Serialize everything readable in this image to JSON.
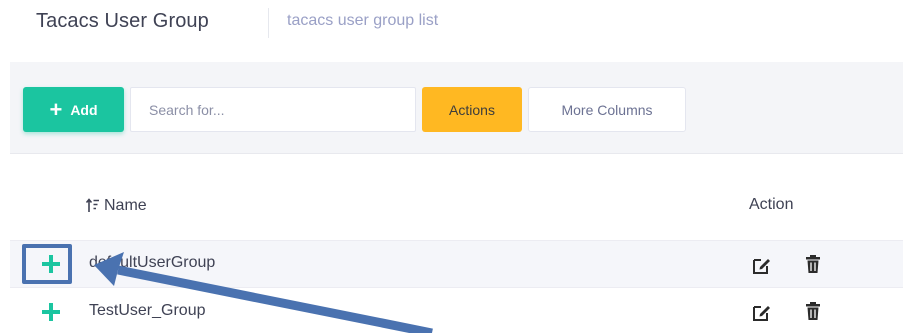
{
  "header": {
    "title": "Tacacs User Group",
    "subtitle": "tacacs user group list"
  },
  "toolbar": {
    "add_label": "Add",
    "search_placeholder": "Search for...",
    "actions_label": "Actions",
    "more_columns_label": "More Columns"
  },
  "table": {
    "columns": [
      "Name",
      "Action"
    ],
    "rows": [
      {
        "name": "defaultUserGroup"
      },
      {
        "name": "TestUser_Group"
      }
    ]
  },
  "colors": {
    "accent_green": "#1bc5a0",
    "actions_yellow": "#ffb822",
    "annotation_blue": "#4a72b0"
  }
}
